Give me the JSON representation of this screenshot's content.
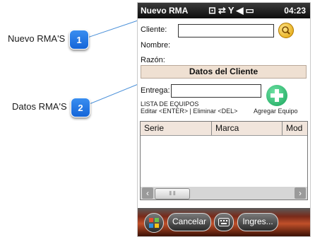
{
  "callouts": [
    {
      "number": "1",
      "label": "Nuevo RMA'S"
    },
    {
      "number": "2",
      "label": "Datos RMA'S"
    }
  ],
  "statusbar": {
    "title": "Nuevo RMA",
    "time": "04:23",
    "icons": [
      "keyboard-indicator-icon",
      "connectivity-icon",
      "no-signal-icon",
      "volume-icon",
      "battery-icon"
    ]
  },
  "form": {
    "cliente_label": "Cliente:",
    "cliente_value": "",
    "nombre_label": "Nombre:",
    "razon_label": "Razón:",
    "section_title": "Datos del Cliente",
    "entrega_label": "Entrega:",
    "entrega_value": "",
    "lista_label": "LISTA DE EQUIPOS",
    "hint": "Editar <ENTER> | Eliminar <DEL>",
    "add_label": "Agregar Equipo"
  },
  "table": {
    "columns": [
      "Serie",
      "Marca",
      "Mod"
    ],
    "rows": []
  },
  "menubar": {
    "cancel_label": "Cancelar",
    "ingres_label": "Ingres..."
  }
}
